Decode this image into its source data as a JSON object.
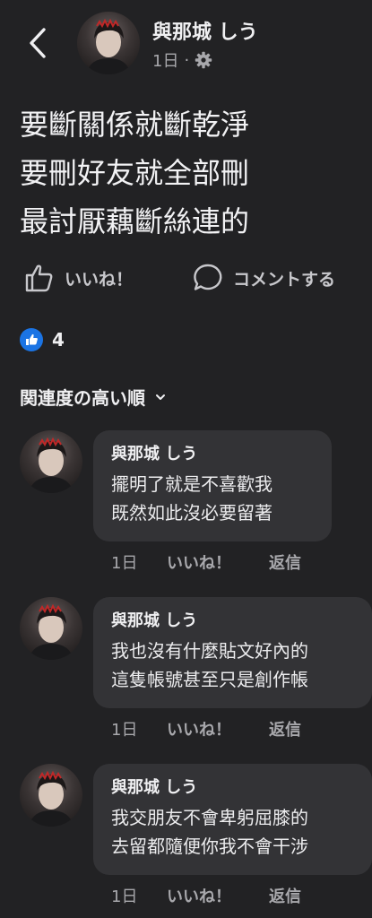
{
  "header": {
    "name": "與那城 しう",
    "time": "1日",
    "separator": "·",
    "privacy_icon": "gear-icon",
    "back_icon": "back-arrow-icon"
  },
  "post": {
    "lines": [
      "要斷關係就斷乾淨",
      "要刪好友就全部刪",
      "最討厭藕斷絲連的"
    ]
  },
  "actions": {
    "like_label": "いいね！",
    "comment_label": "コメントする"
  },
  "reactions": {
    "icon": "thumbs-up-icon",
    "count": "4"
  },
  "sort": {
    "label": "関連度の高い順"
  },
  "comments": [
    {
      "name": "與那城 しう",
      "lines": [
        "擺明了就是不喜歡我",
        "既然如此沒必要留著"
      ],
      "time": "1日",
      "like": "いいね！",
      "reply": "返信"
    },
    {
      "name": "與那城 しう",
      "lines": [
        "我也沒有什麼貼文好內的",
        "這隻帳號甚至只是創作帳"
      ],
      "time": "1日",
      "like": "いいね！",
      "reply": "返信"
    },
    {
      "name": "與那城 しう",
      "lines": [
        "我交朋友不會卑躬屈膝的",
        "去留都隨便你我不會干涉"
      ],
      "time": "1日",
      "like": "いいね！",
      "reply": "返信"
    }
  ],
  "colors": {
    "background": "#222224",
    "bubble": "#333336",
    "accent_blue": "#1b74e4",
    "muted_text": "#a8a8ac"
  }
}
